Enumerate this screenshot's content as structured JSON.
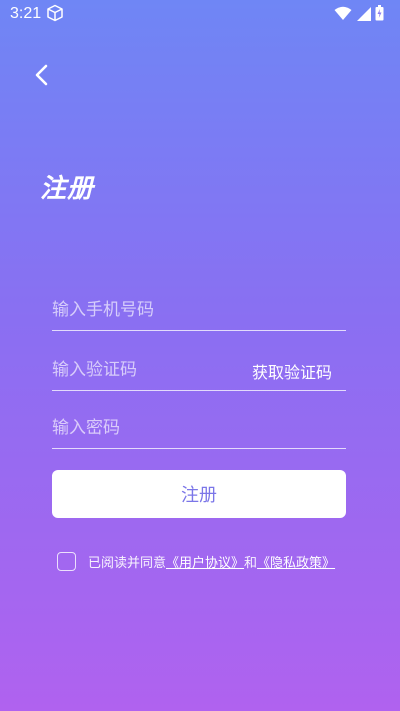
{
  "status": {
    "time": "3:21"
  },
  "title": "注册",
  "form": {
    "phone_placeholder": "输入手机号码",
    "code_placeholder": "输入验证码",
    "get_code_label": "获取验证码",
    "password_placeholder": "输入密码",
    "submit_label": "注册"
  },
  "agreement": {
    "prefix": "已阅读并同意",
    "user_agreement": "《用户协议》",
    "and": "和",
    "privacy_policy": "《隐私政策》",
    "checked": false
  },
  "icons": {
    "status": [
      "cube-icon",
      "wifi-icon",
      "signal-icon",
      "battery-icon"
    ],
    "back": "chevron-left-icon"
  },
  "colors": {
    "gradient_top": "#6f86f5",
    "gradient_bottom": "#b062ef",
    "button_text": "#7b76e8"
  }
}
